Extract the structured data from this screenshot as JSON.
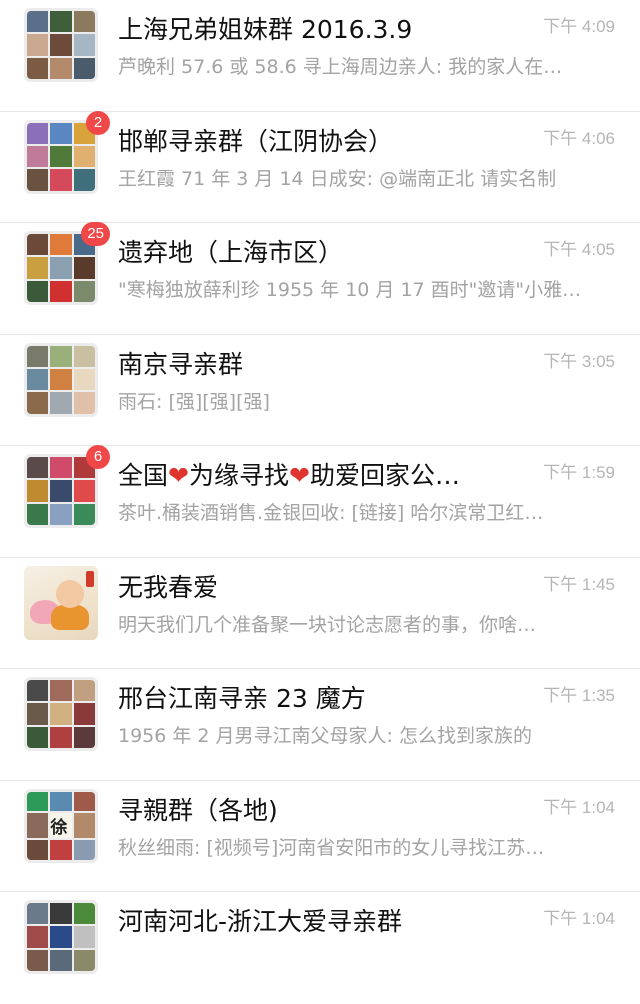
{
  "chats": [
    {
      "title": "上海兄弟姐妹群 2016.3.9",
      "time": "下午 4:09",
      "preview": "芦晚利 57.6 或 58.6 寻上海周边亲人: 我的家人在…",
      "badge": "",
      "avatar_colors": [
        "#5a6f8a",
        "#3f5f3a",
        "#8c7a5f",
        "#c9a88f",
        "#6d4b3a",
        "#a7b6c5",
        "#7c5b44",
        "#b48a6d",
        "#4a5b6c"
      ]
    },
    {
      "title": "邯郸寻亲群（江阴协会）",
      "time": "下午 4:06",
      "preview": "王红霞 71 年 3 月 14 日成安: @端南正北 请实名制",
      "badge": "2",
      "avatar_colors": [
        "#8b6fb8",
        "#5a86c2",
        "#d9a33c",
        "#c07a9a",
        "#4f7a3a",
        "#e0b070",
        "#6a5240",
        "#d44a5a",
        "#3f6f7a"
      ]
    },
    {
      "title": "遗弃地（上海市区）",
      "time": "下午 4:05",
      "preview": "\"寒梅独放薛利珍 1955 年 10 月 17 酉时\"邀请\"小雅…",
      "badge": "25",
      "avatar_colors": [
        "#6b4a3a",
        "#e07a3a",
        "#4a6a8a",
        "#c9a040",
        "#8aa0b0",
        "#5a3a2a",
        "#3a5a3a",
        "#d03030",
        "#7a8a6a"
      ]
    },
    {
      "title": "南京寻亲群",
      "time": "下午 3:05",
      "preview": "雨石: [强][强][强]",
      "badge": "",
      "avatar_colors": [
        "#7a7a6a",
        "#9ab07a",
        "#c8c0a0",
        "#6a8aa0",
        "#d08040",
        "#e8d8c0",
        "#8a6a4a",
        "#a0a8b0",
        "#e0c0a8"
      ]
    },
    {
      "title_parts": [
        "全国",
        "❤",
        "为缘寻找",
        "❤",
        "助爱回家公…"
      ],
      "time": "下午 1:59",
      "preview": "茶叶.桶装酒销售.金银回收: [链接] 哈尔滨常卫红…",
      "badge": "6",
      "avatar_colors": [
        "#5a4a4a",
        "#d04a6a",
        "#b03a3a",
        "#c08a30",
        "#3a4a6a",
        "#e04a4a",
        "#3a7a4a",
        "#8aa0c0",
        "#3a8a5a"
      ]
    },
    {
      "title": "无我春爱",
      "time": "下午 1:45",
      "preview": "明天我们几个准备聚一块讨论志愿者的事，你啥…",
      "badge": ""
    },
    {
      "title": "邢台江南寻亲 23 魔方",
      "time": "下午 1:35",
      "preview": "1956 年 2 月男寻江南父母家人: 怎么找到家族的",
      "badge": "",
      "avatar_colors": [
        "#4a4a4a",
        "#a06a5a",
        "#c0a080",
        "#6a5a4a",
        "#d0b080",
        "#8a3a3a",
        "#3a5a3a",
        "#b04040",
        "#5a3a3a"
      ]
    },
    {
      "title": "寻親群（各地)",
      "time": "下午 1:04",
      "preview": "秋丝细雨: [视频号]河南省安阳市的女儿寻找江苏…",
      "badge": "",
      "avatar_text": "徐",
      "avatar_colors": [
        "#2e9a5a",
        "#5a8ab0",
        "#a05a4a",
        "#8a6a5a",
        "#f7f4ea",
        "#b08a6a",
        "#6a4a3a",
        "#c04040",
        "#8a9ab0"
      ]
    },
    {
      "title": "河南河北-浙江大爱寻亲群",
      "time": "下午 1:04",
      "preview": "",
      "badge": "",
      "avatar_colors": [
        "#6a7a8a",
        "#3a3a3a",
        "#4a8a3a",
        "#a04a4a",
        "#2a4a8a",
        "#c0c0c0",
        "#7a5a4a",
        "#5a6a7a",
        "#8a8a6a"
      ]
    }
  ]
}
